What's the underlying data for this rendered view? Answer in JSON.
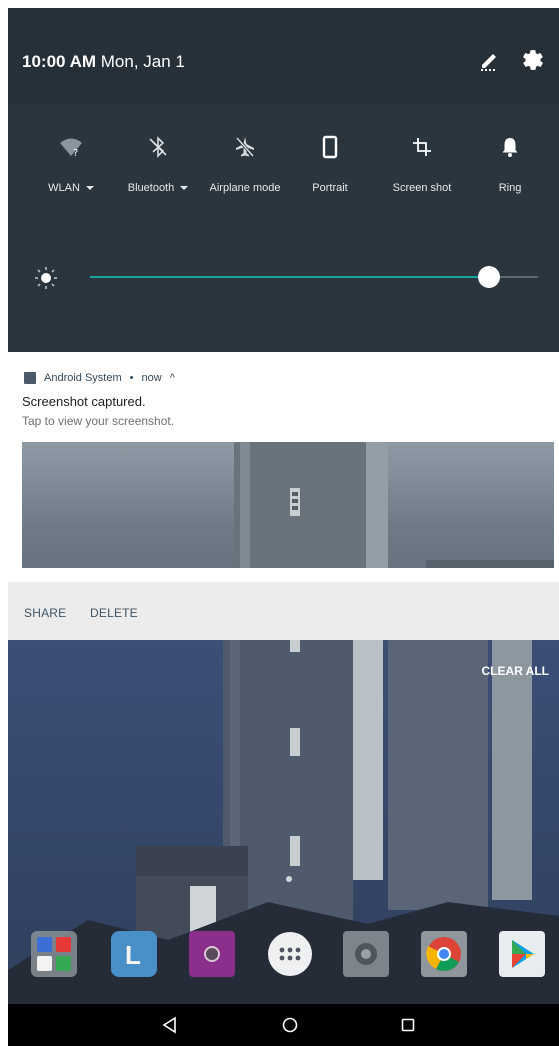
{
  "status": {
    "time": "10:00 AM",
    "date": "Mon, Jan 1"
  },
  "header_icons": [
    "edit-icon",
    "gear-icon"
  ],
  "quick_settings": {
    "tiles": [
      {
        "name": "wlan",
        "label": "WLAN",
        "icon": "wifi-unknown-icon",
        "has_dropdown": true
      },
      {
        "name": "bluetooth",
        "label": "Bluetooth",
        "icon": "bluetooth-off-icon",
        "has_dropdown": true
      },
      {
        "name": "airplane-mode",
        "label": "Airplane mode",
        "icon": "airplane-off-icon",
        "has_dropdown": false
      },
      {
        "name": "portrait",
        "label": "Portrait",
        "icon": "portrait-icon",
        "has_dropdown": false
      },
      {
        "name": "screen-shot",
        "label": "Screen shot",
        "icon": "crop-icon",
        "has_dropdown": false
      },
      {
        "name": "ring",
        "label": "Ring",
        "icon": "bell-icon",
        "has_dropdown": false
      }
    ],
    "brightness_level": 0.86
  },
  "notification": {
    "app_name": "Android System",
    "separator": "•",
    "when": "now",
    "expand_glyph": "^",
    "title": "Screenshot captured.",
    "text": "Tap to view your screenshot.",
    "actions": {
      "share": "SHARE",
      "delete": "DELETE"
    }
  },
  "home": {
    "clear_all": "CLEAR ALL",
    "dock_apps": [
      "folder-google-apps-icon",
      "launcher-l-icon",
      "camera-app-icon",
      "app-drawer-icon",
      "settings-app-icon",
      "chrome-icon",
      "play-store-icon"
    ],
    "nav": [
      "back-icon",
      "home-icon",
      "recents-icon"
    ]
  },
  "colors": {
    "qs_background": "#2b353d",
    "qs_header": "#263038",
    "accent": "#1aa39b",
    "notification_bg": "#ffffff",
    "actions_bg": "#ececec"
  }
}
